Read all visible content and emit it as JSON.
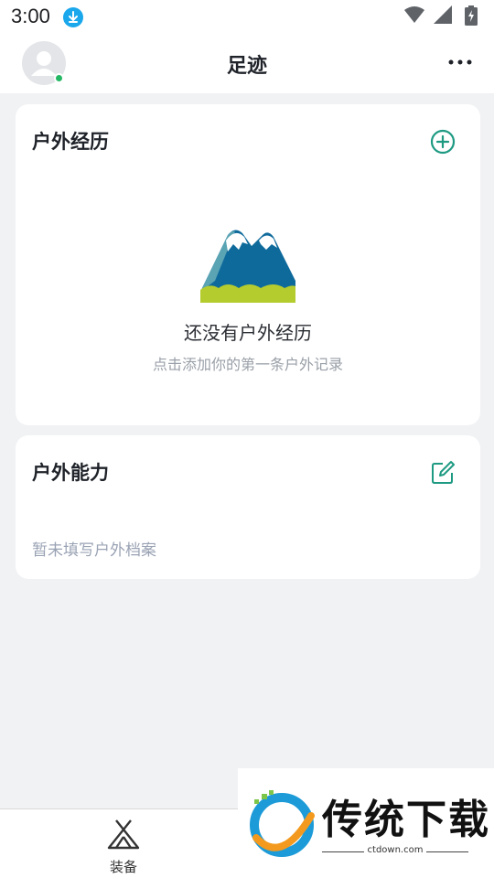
{
  "status_bar": {
    "time": "3:00",
    "icons": [
      "download-icon",
      "wifi-icon",
      "signal-icon",
      "battery-charging-icon"
    ]
  },
  "header": {
    "title": "足迹",
    "avatar_icon": "user-avatar-icon",
    "more_icon": "more-dots-icon"
  },
  "experience_card": {
    "title": "户外经历",
    "action_icon": "add-circle-icon",
    "empty_title": "还没有户外经历",
    "empty_subtitle": "点击添加你的第一条户外记录",
    "illustration": "mountain-illustration"
  },
  "ability_card": {
    "title": "户外能力",
    "action_icon": "edit-icon",
    "empty_text": "暂未填写户外档案"
  },
  "bottom_nav": {
    "items": [
      {
        "label": "装备",
        "icon": "tent-icon"
      }
    ]
  },
  "watermark": {
    "text": "传统下载",
    "url": "ctdown.com"
  },
  "colors": {
    "accent": "#1e9a82",
    "online": "#25b864",
    "background": "#f1f2f4",
    "mountain_blue": "#0f6a9c",
    "grass": "#b5cc2e"
  }
}
